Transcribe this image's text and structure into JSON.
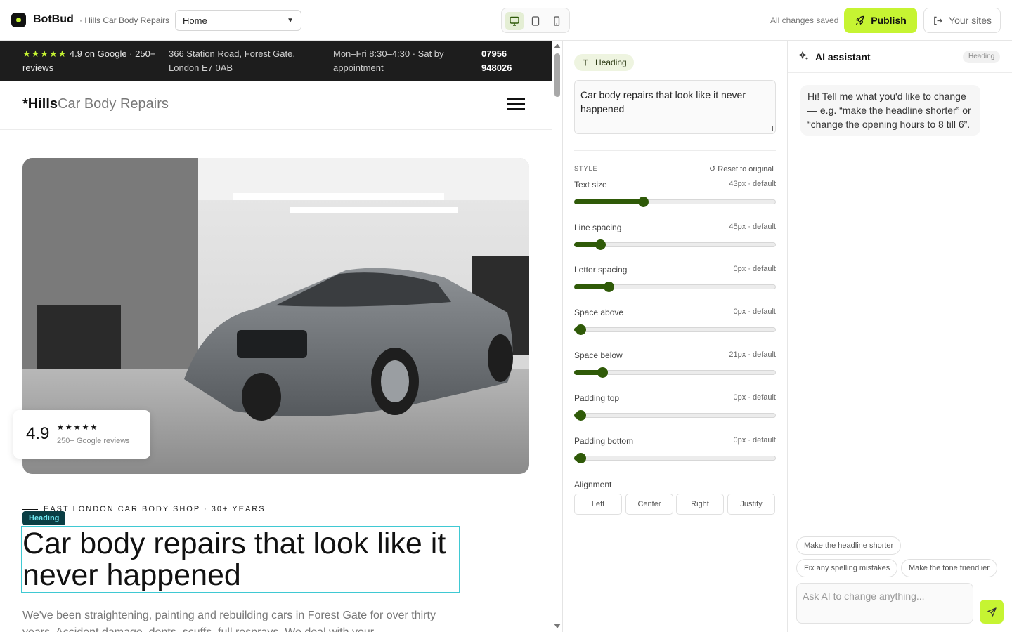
{
  "app": {
    "logo_text": "BotBud",
    "site_name": "· Hills Car Body Repairs",
    "page_select": "Home",
    "saved_status": "All changes saved",
    "publish_label": "Publish",
    "your_sites_label": "Your sites",
    "accent": "#c6f432",
    "devices": [
      {
        "name": "desktop",
        "active": true
      },
      {
        "name": "tablet",
        "active": false
      },
      {
        "name": "mobile",
        "active": false
      }
    ]
  },
  "preview": {
    "infobar": {
      "stars": "★★★★★",
      "rating_text": " 4.9 on Google · 250+",
      "rating_text_2": "reviews",
      "address_1": "366 Station Road, Forest Gate,",
      "address_2": "London E7 0AB",
      "hours_1": "Mon–Fri 8:30–4:30 · Sat by",
      "hours_2": "appointment",
      "phone_1": "07956",
      "phone_2": "948026"
    },
    "brand": {
      "asterisk": "*",
      "bold": "Hills",
      "light": "Car Body Repairs"
    },
    "rating_card": {
      "score": "4.9",
      "stars": "★★★★★",
      "sub": "250+ Google reviews"
    },
    "eyebrow": "EAST LONDON CAR BODY SHOP · 30+ YEARS",
    "selection_tag": "Heading",
    "heading": "Car body repairs that look like it never happened",
    "paragraph": "We've been straightening, painting and rebuilding cars in Forest Gate for over thirty years. Accident damage, dents, scuffs, full resprays. We deal with your"
  },
  "editor": {
    "element_chip": "Heading",
    "text_value": "Car body repairs that look like it never happened",
    "style_label": "STYLE",
    "reset_label": "Reset to original",
    "sliders": [
      {
        "label": "Text size",
        "value": "43px · default",
        "level": 0.34
      },
      {
        "label": "Line spacing",
        "value": "45px · default",
        "level": 0.13
      },
      {
        "label": "Letter spacing",
        "value": "0px · default",
        "level": 0.17
      },
      {
        "label": "Space above",
        "value": "0px · default",
        "level": 0.03
      },
      {
        "label": "Space below",
        "value": "21px · default",
        "level": 0.14
      },
      {
        "label": "Padding top",
        "value": "0px · default",
        "level": 0.03
      },
      {
        "label": "Padding bottom",
        "value": "0px · default",
        "level": 0.03
      }
    ],
    "alignment_label": "Alignment",
    "alignment_options": [
      "Left",
      "Center",
      "Right",
      "Justify"
    ]
  },
  "ai": {
    "title": "AI assistant",
    "context": "Heading",
    "greeting": "Hi! Tell me what you'd like to change — e.g. “make the headline shorter” or “change the opening hours to 8 till 6”.",
    "suggestions": [
      "Make the headline shorter",
      "Fix any spelling mistakes",
      "Make the tone friendlier"
    ],
    "input_placeholder": "Ask AI to change anything..."
  }
}
